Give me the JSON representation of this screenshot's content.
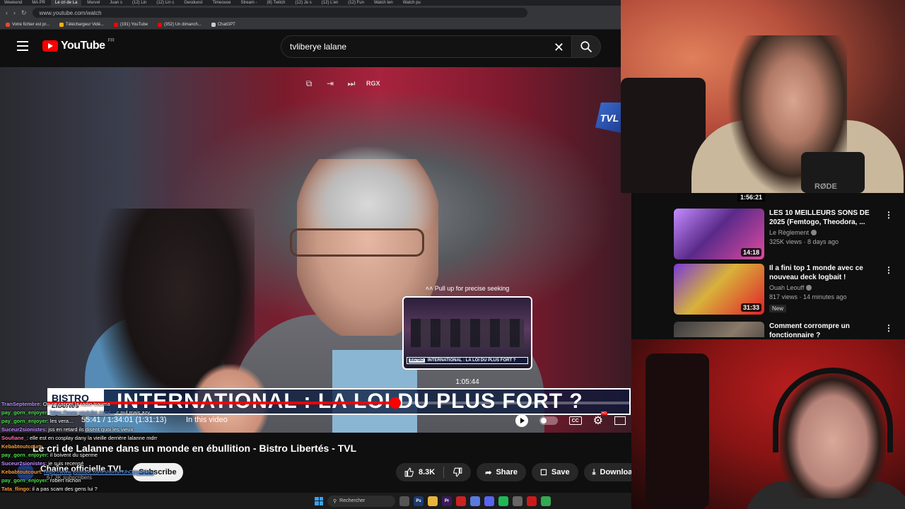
{
  "browser": {
    "tabs": [
      "Weekend",
      "MA PR",
      "Le cri de La",
      "Marvel",
      "Juan s",
      "(12) Lin",
      "(12) Lin c",
      "Geoduest",
      "Timeouse",
      "Stream -",
      "(8) Twitch",
      "(12) Je s",
      "(12) L'en",
      "(12) Fun",
      "Watch ten",
      "Watch pu"
    ],
    "active_tab_index": 2,
    "url": "www.youtube.com/watch",
    "bookmarks": [
      {
        "label": "Votre fichier est pr...",
        "color": "#e8453c"
      },
      {
        "label": "Téléchargeur Vidé...",
        "color": "#f4b400"
      },
      {
        "label": "(191) YouTube",
        "color": "#ff0000"
      },
      {
        "label": "(352) Un dimanch...",
        "color": "#ff0000"
      },
      {
        "label": "ChatGPT",
        "color": "#cccccc"
      }
    ]
  },
  "header": {
    "logo_text": "YouTube",
    "region": "FR",
    "search_value": "tvliberye lalane"
  },
  "player": {
    "top_controls": {
      "rgx": "RGX"
    },
    "channel_logo": "TVL",
    "seek_hint": "Pull up for precise seeking",
    "seek_preview_banner": "INTERNATIONAL : LA LOI DU PLUS FORT ?",
    "seek_time": "1:05:44",
    "banner_logo_line1": "BISTRO",
    "banner_logo_line2": "Libertés",
    "banner_text": "INTERNATIONAL : LA LOI DU PLUS FORT ?",
    "progress_fraction": 0.596,
    "time_display": "55:41 / 1:34:01 (1:31:13)",
    "chapter_label": "In this video",
    "cc_label": "CC",
    "hd_badge": "HD"
  },
  "video": {
    "title": "Le cri de Lalanne dans un monde en ébullition - Bistro Libertés - TVL",
    "channel_name": "Chaîne officielle TVL",
    "channel_subs": "67.3K subscribers",
    "subscribe_label": "Subscribe",
    "like_count": "8.3K",
    "share_label": "Share",
    "save_label": "Save",
    "download_label": "Download"
  },
  "chat": [
    {
      "user": "TranSeptembre",
      "color": "#b58cff",
      "text": "On se rappel la radio trauma"
    },
    {
      "user": "pay_gorn_enjoyer",
      "color": "#4ee04e",
      "text": "c nul mais azy",
      "link": "https://www.youtube.com/..."
    },
    {
      "user": "pay_gorn_enjoyer",
      "color": "#4ee04e",
      "text": "les vera..."
    },
    {
      "user": "Suceur2sionistes",
      "color": "#c08cff",
      "text": "jss en retard ils disent quoi les vieux"
    },
    {
      "user": "Soufiane_",
      "color": "#ff6fb0",
      "text": "elle est en cosplay dany la vieille derrière lalanne mdrr"
    },
    {
      "user": "Kebabtoutcourt",
      "color": "#ff9a3c",
      "text": "..."
    },
    {
      "user": "pay_gorn_enjoyer",
      "color": "#4ee04e",
      "text": "il boivent du sperme"
    },
    {
      "user": "Suceur2sionistes",
      "color": "#c08cff",
      "text": "je suis recensé"
    },
    {
      "user": "Kebabtoutcourt",
      "color": "#ff9a3c",
      "text": "",
      "link": "https://www.youtube.com/shorts/rUhOqwtwlww"
    },
    {
      "user": "pay_gorn_enjoyer",
      "color": "#4ee04e",
      "text": "robert nichon"
    },
    {
      "user": "Tata_flingo",
      "color": "#ff9a3c",
      "text": "il a pas scam des gens lui ?"
    }
  ],
  "taskbar": {
    "search_label": "Rechercher",
    "apps": [
      {
        "label": "",
        "color": "#555555"
      },
      {
        "label": "Ps",
        "color": "#1c3a6e"
      },
      {
        "label": "",
        "color": "#e8b53c"
      },
      {
        "label": "Pr",
        "color": "#3a1a5a"
      },
      {
        "label": "",
        "color": "#cc2222"
      },
      {
        "label": "",
        "color": "#5a7adf"
      },
      {
        "label": "",
        "color": "#5865f2"
      },
      {
        "label": "",
        "color": "#1db954"
      },
      {
        "label": "",
        "color": "#666666"
      },
      {
        "label": "",
        "color": "#cc1a1a"
      },
      {
        "label": "",
        "color": "#34a853"
      }
    ]
  },
  "recommendations": [
    {
      "title": "LES 10 MEILLEURS SONS DE 2025 (Femtogo, Theodora, ...",
      "channel": "Le Règlement",
      "meta": "325K views · 8 days ago",
      "duration": "14:18",
      "thumb": "linear-gradient(135deg,#c58cff 0%,#5a2a8a 45%,#e04aa0 100%)"
    },
    {
      "title": "Il a fini top 1 monde avec ce nouveau deck logbait !",
      "channel": "Ouah Leouff",
      "meta": "817 views · 14 minutes ago",
      "duration": "31:33",
      "badge": "New",
      "thumb": "linear-gradient(135deg,#7a3ad8 0%,#d8b23a 45%,#e0202a 100%)"
    },
    {
      "title": "Comment corrompre un fonctionnaire ?",
      "channel": "",
      "meta": "",
      "duration": "",
      "thumb": "linear-gradient(135deg,#3a3a3a 0%,#8a7a6a 50%,#2a2a2a 100%)"
    }
  ],
  "webcam_top": {
    "mic_brand": "RØDE",
    "duration": "1:56:21"
  }
}
